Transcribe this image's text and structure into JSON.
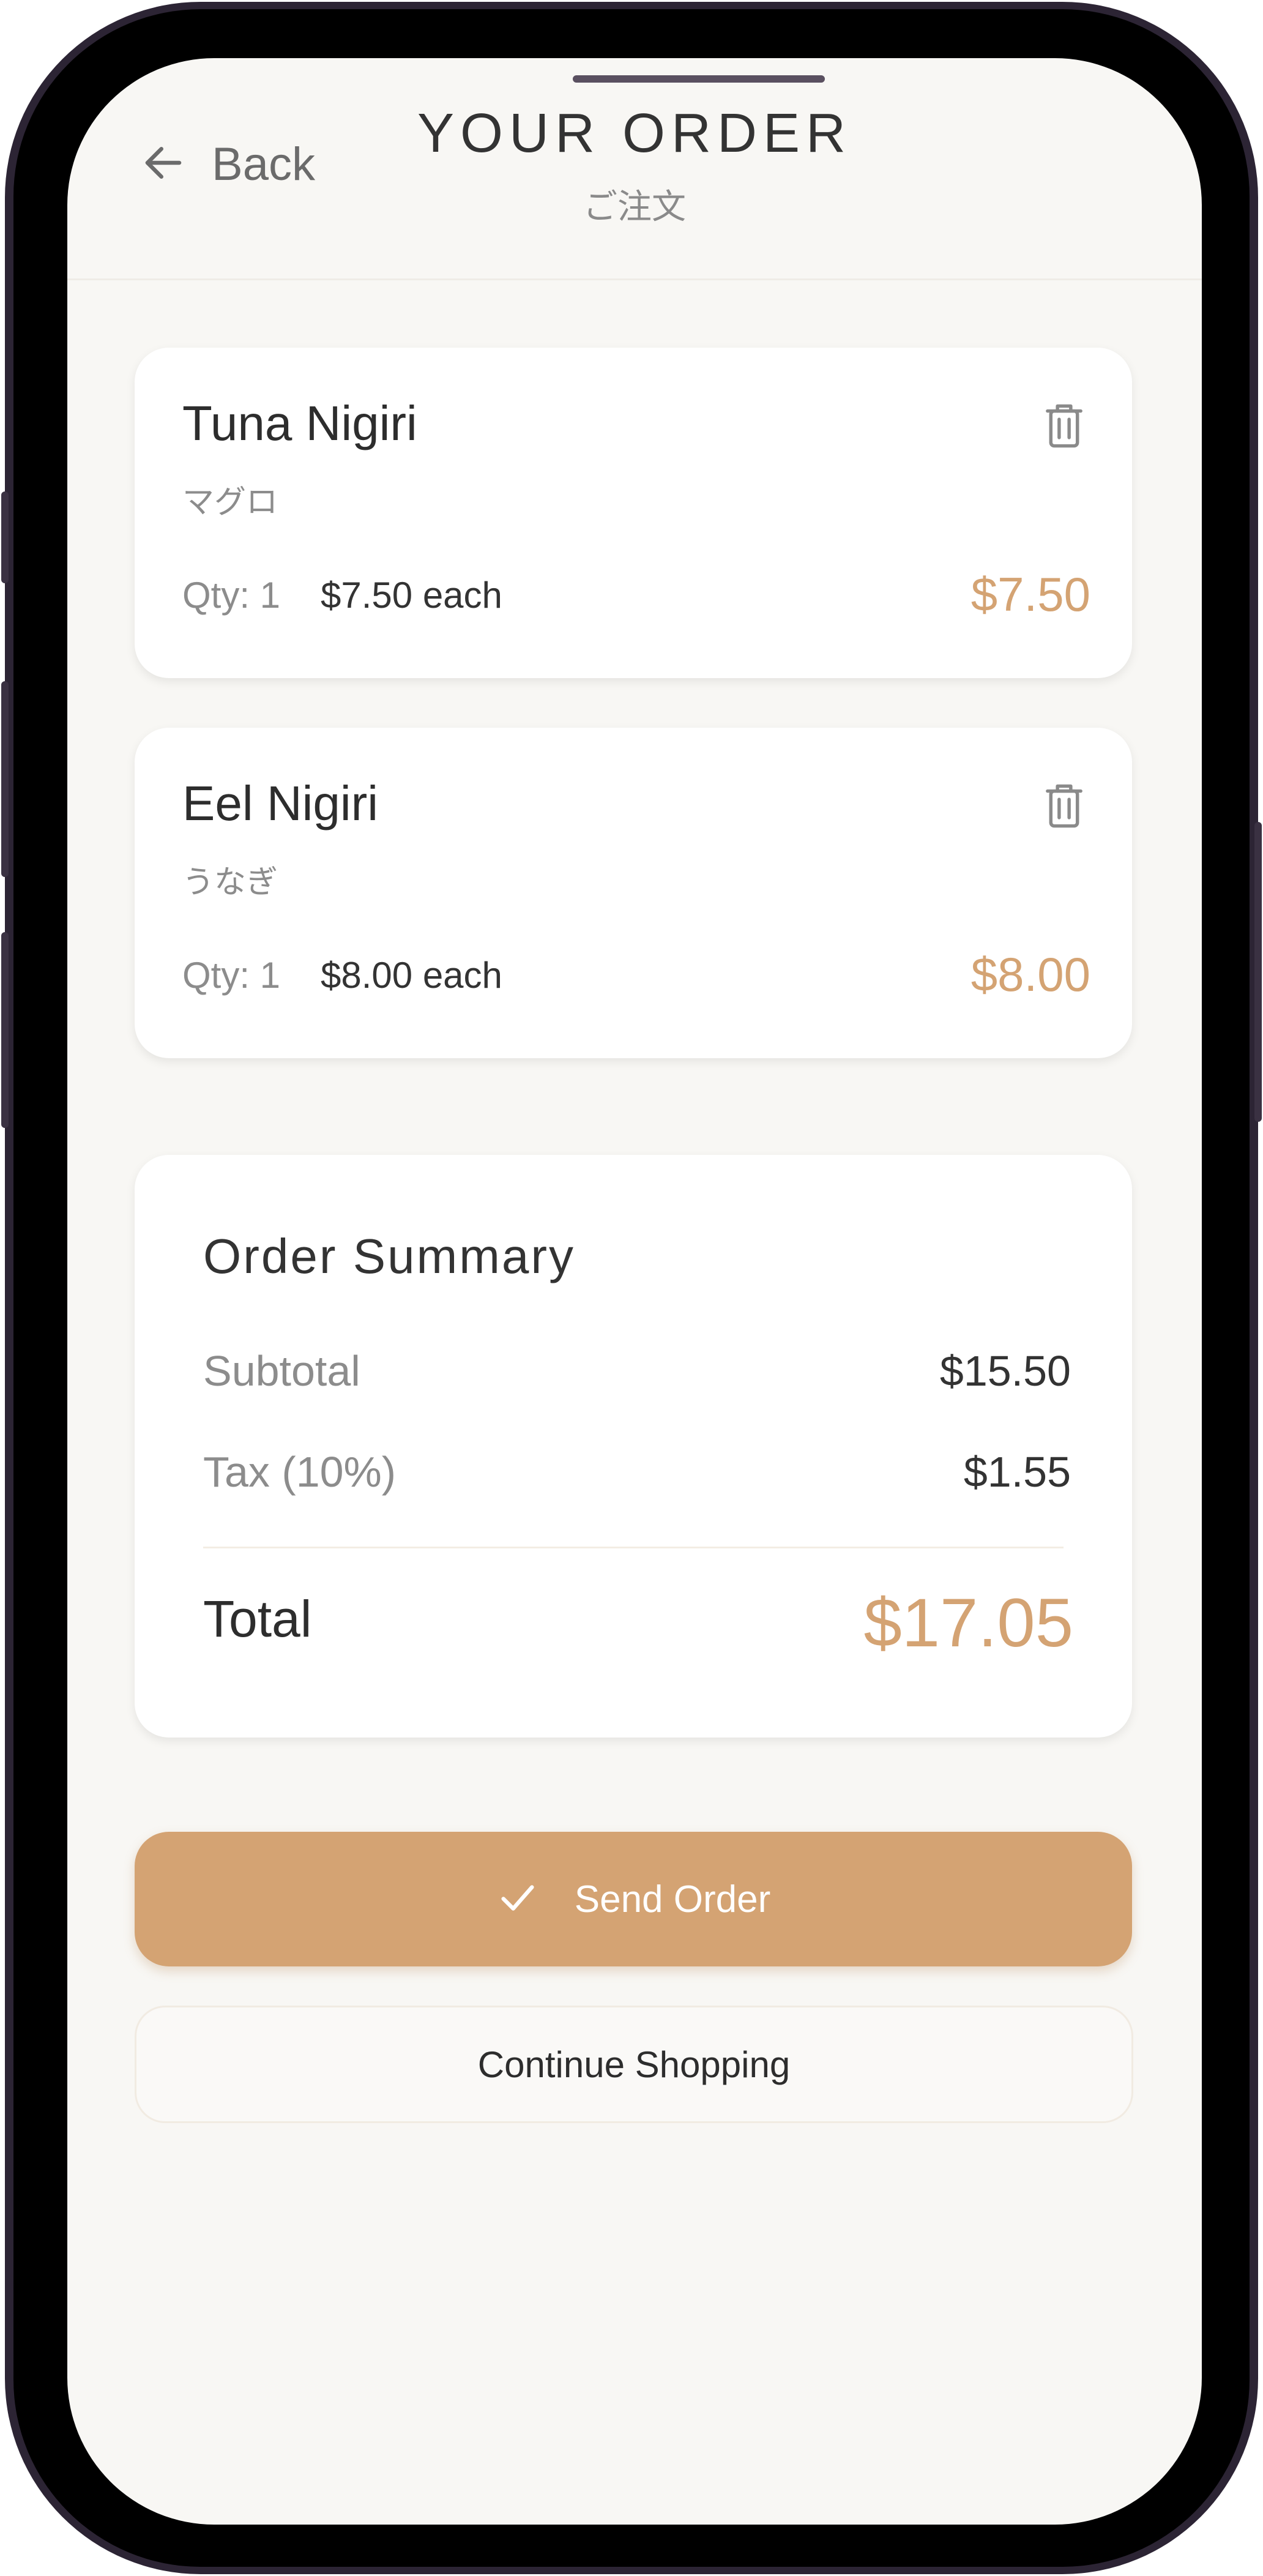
{
  "header": {
    "back_label": "Back",
    "title": "YOUR ORDER",
    "subtitle": "ご注文"
  },
  "items": [
    {
      "name": "Tuna Nigiri",
      "name_jp": "マグロ",
      "qty_label": "Qty: 1",
      "unit_price_label": "$7.50 each",
      "line_total": "$7.50"
    },
    {
      "name": "Eel Nigiri",
      "name_jp": "うなぎ",
      "qty_label": "Qty: 1",
      "unit_price_label": "$8.00 each",
      "line_total": "$8.00"
    }
  ],
  "summary": {
    "title": "Order Summary",
    "subtotal_label": "Subtotal",
    "subtotal_value": "$15.50",
    "tax_label": "Tax (10%)",
    "tax_value": "$1.55",
    "total_label": "Total",
    "total_value": "$17.05"
  },
  "actions": {
    "send_order_label": "Send Order",
    "continue_label": "Continue Shopping"
  },
  "colors": {
    "accent": "#d4a373",
    "background": "#f8f7f4",
    "card": "#ffffff",
    "text": "#333333",
    "muted": "#8c8c8c"
  },
  "icons": {
    "back": "arrow-left-icon",
    "delete": "trash-icon",
    "confirm": "check-icon"
  }
}
